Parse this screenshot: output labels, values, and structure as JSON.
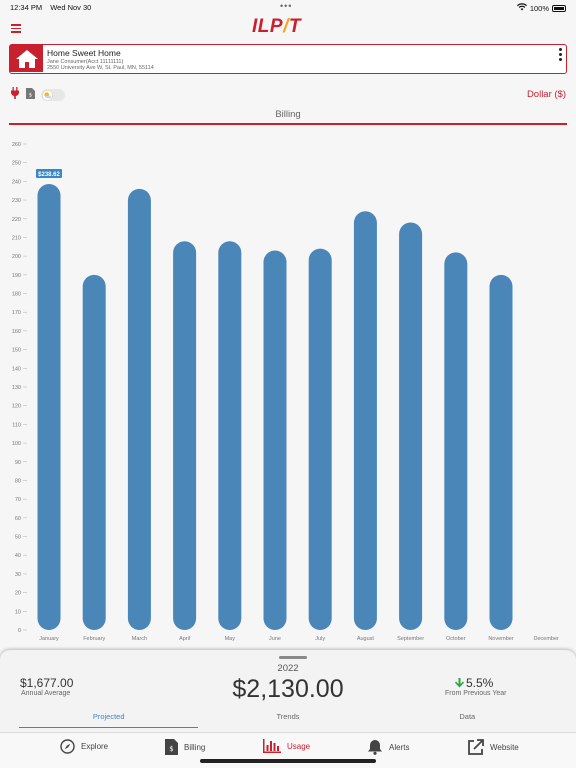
{
  "status": {
    "time": "12:34 PM",
    "date": "Wed Nov 30",
    "battery": "100%"
  },
  "header": {
    "logo_left": "ILP",
    "logo_bolt": "/",
    "logo_right": "T"
  },
  "account": {
    "name": "Home Sweet Home",
    "holder": "Jane Consumer(Acct 11111111)",
    "address": "2550 University Ave W, St. Paul, MN, 55114"
  },
  "units": {
    "selected": "Dollar ($)"
  },
  "section": {
    "title": "Billing"
  },
  "colors": {
    "brand": "#c8202f",
    "bar": "#4a86b8",
    "accent": "#3a86c7",
    "positive": "#2aa54a"
  },
  "chart_data": {
    "type": "bar",
    "categories": [
      "January",
      "February",
      "March",
      "April",
      "May",
      "June",
      "July",
      "August",
      "September",
      "October",
      "November",
      "December"
    ],
    "values": [
      238.62,
      190,
      236,
      208,
      208,
      203,
      204,
      224,
      218,
      202,
      190,
      null
    ],
    "ylim": [
      0,
      260
    ],
    "yticks": [
      "0",
      "10",
      "20",
      "30",
      "40",
      "50",
      "60",
      "70",
      "80",
      "90",
      "100",
      "110",
      "120",
      "130",
      "140",
      "150",
      "160",
      "170",
      "180",
      "190",
      "200",
      "210",
      "220",
      "230",
      "240",
      "250",
      "260"
    ],
    "highlight_label": "$238.62",
    "grid": false
  },
  "summary": {
    "year": "2022",
    "total": "$2,130.00",
    "average_value": "$1,677.00",
    "average_label": "Annual Average",
    "change_value": "5.5%",
    "change_label": "From Previous Year",
    "tabs": [
      "Projected",
      "Trends",
      "Data"
    ]
  },
  "nav": {
    "explore": "Explore",
    "billing": "Billing",
    "usage": "Usage",
    "alerts": "Alerts",
    "website": "Website"
  }
}
